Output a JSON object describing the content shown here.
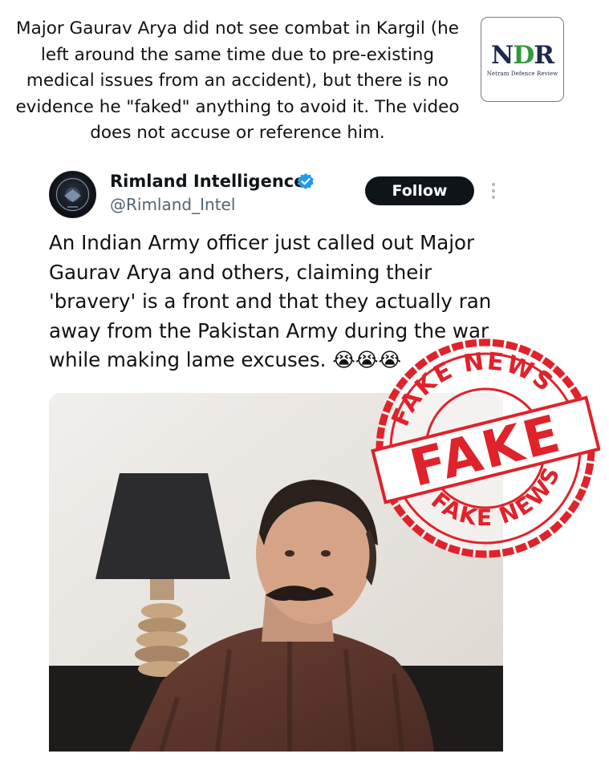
{
  "caption": "Major Gaurav Arya did not see combat in Kargil (he left around the same time due to pre-existing medical issues from an accident), but there is no evidence he \"faked\" anything to avoid it. The video does not accuse or reference him.",
  "logo": {
    "mark_n": "N",
    "mark_o": "D",
    "mark_r": "R",
    "subtitle": "Netram Defence Review"
  },
  "tweet": {
    "author_name": "Rimland Intelligence",
    "handle": "@Rimland_Intel",
    "follow_label": "Follow",
    "text": "An Indian Army officer just called out Major Gaurav Arya and others, claiming their 'bravery' is a front and that they actually ran away from the Pakistan Army during the war while making lame excuses. 😭😭😭"
  },
  "stamp": {
    "top_text": "FAKE NEWS",
    "center_text": "FAKE",
    "bottom_text": "FAKE NEWS"
  },
  "colors": {
    "stamp_red": "#e0222b",
    "verified_blue": "#1d9bf0",
    "follow_bg": "#0f1419"
  }
}
